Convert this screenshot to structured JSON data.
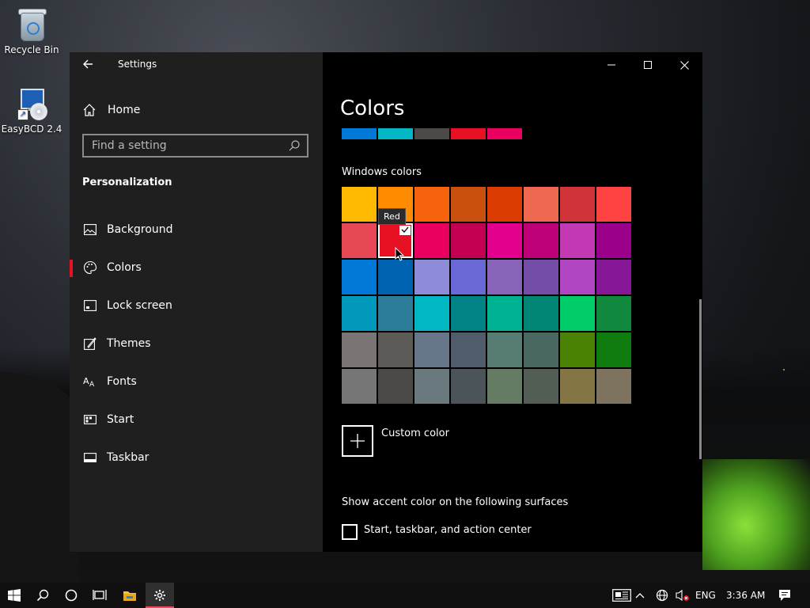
{
  "desktop": {
    "icons": [
      {
        "label": "Recycle Bin"
      },
      {
        "label": "EasyBCD 2.4"
      }
    ]
  },
  "window": {
    "title": "Settings",
    "controls": {
      "minimize": "minimize-icon",
      "maximize": "maximize-icon",
      "close": "close-icon"
    }
  },
  "sidebar": {
    "home_label": "Home",
    "search_placeholder": "Find a setting",
    "section_label": "Personalization",
    "items": [
      {
        "label": "Background",
        "icon": "picture-icon"
      },
      {
        "label": "Colors",
        "icon": "palette-icon",
        "active": true
      },
      {
        "label": "Lock screen",
        "icon": "lock-screen-icon"
      },
      {
        "label": "Themes",
        "icon": "themes-icon"
      },
      {
        "label": "Fonts",
        "icon": "fonts-icon"
      },
      {
        "label": "Start",
        "icon": "start-icon"
      },
      {
        "label": "Taskbar",
        "icon": "taskbar-icon"
      }
    ]
  },
  "content": {
    "title": "Colors",
    "recent_colors": [
      "#0078d7",
      "#00b7c3",
      "#4c4a48",
      "#e81123",
      "#ea005e"
    ],
    "windows_colors_label": "Windows colors",
    "swatches": [
      "#ffb900",
      "#ff8c00",
      "#f7630c",
      "#ca5010",
      "#da3b01",
      "#ef6950",
      "#d13438",
      "#ff4343",
      "#e74856",
      "#e81123",
      "#ea005e",
      "#c30052",
      "#e3008c",
      "#bf0077",
      "#c239b3",
      "#9a0089",
      "#0078d7",
      "#0063b1",
      "#8e8cd8",
      "#6b69d6",
      "#8764b8",
      "#744da9",
      "#b146c2",
      "#881798",
      "#0099bc",
      "#2d7d9a",
      "#00b7c3",
      "#038387",
      "#00b294",
      "#018574",
      "#00cc6a",
      "#10893e",
      "#7a7574",
      "#5d5a58",
      "#68768a",
      "#515c6b",
      "#567c73",
      "#486860",
      "#498205",
      "#107c10",
      "#767676",
      "#4c4a48",
      "#69797e",
      "#4a5459",
      "#647c64",
      "#525e54",
      "#847545",
      "#7e735f"
    ],
    "selected_swatch_index": 9,
    "tooltip": "Red",
    "custom_color_label": "Custom color",
    "accent_surfaces_label": "Show accent color on the following surfaces",
    "checkbox_label": "Start, taskbar, and action center",
    "accent_color": "#e81123"
  },
  "taskbar": {
    "language": "ENG",
    "time": "3:36 AM"
  }
}
